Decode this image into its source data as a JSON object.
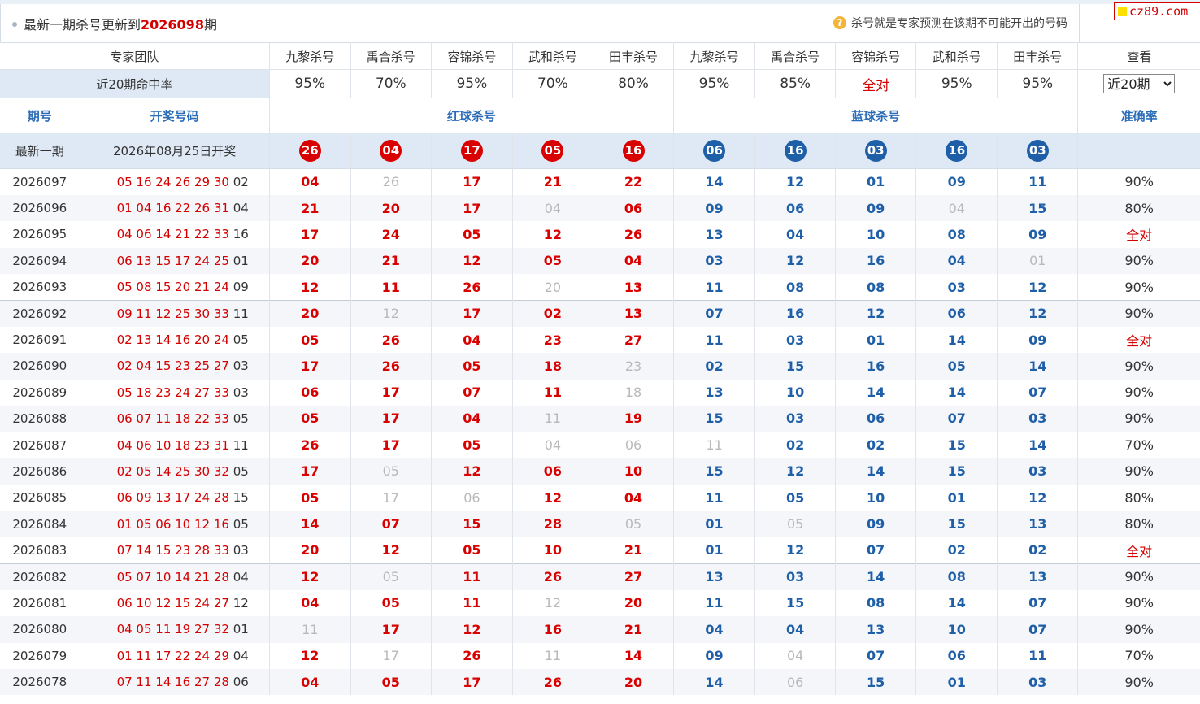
{
  "header": {
    "title_prefix": "最新一期杀号更新到",
    "issue": "2026098",
    "title_suffix": "期",
    "note": "杀号就是专家预测在该期不可能开出的号码",
    "help_glyph": "?"
  },
  "logo": {
    "text": "cz89.com"
  },
  "team": {
    "label": "专家团队",
    "experts": [
      "九黎杀号",
      "禹合杀号",
      "容锦杀号",
      "武和杀号",
      "田丰杀号",
      "九黎杀号",
      "禹合杀号",
      "容锦杀号",
      "武和杀号",
      "田丰杀号"
    ],
    "view_label": "查看"
  },
  "rate": {
    "label": "近20期命中率",
    "values": [
      "95%",
      "70%",
      "95%",
      "70%",
      "80%",
      "95%",
      "85%",
      "全对",
      "95%",
      "95%"
    ],
    "select_value": "近20期"
  },
  "section": {
    "issue_label": "期号",
    "draw_label": "开奖号码",
    "red_label": "红球杀号",
    "blue_label": "蓝球杀号",
    "acc_label": "准确率"
  },
  "latest": {
    "label": "最新一期",
    "date": "2026年08月25日开奖",
    "red": [
      "26",
      "04",
      "17",
      "05",
      "16"
    ],
    "blue": [
      "06",
      "16",
      "03",
      "16",
      "03"
    ]
  },
  "colors": {
    "red": "#d90000",
    "blue": "#1f5fa8",
    "accent_bg": "#dfe9f5",
    "miss": "#b9b9b9"
  },
  "rows": [
    {
      "issue": "2026097",
      "reds": "05 16 24 26 29 30",
      "blue": "02",
      "kills": [
        "04",
        "26",
        "17",
        "21",
        "22",
        "14",
        "12",
        "01",
        "09",
        "11"
      ],
      "miss": [
        1
      ],
      "acc": "90%"
    },
    {
      "issue": "2026096",
      "reds": "01 04 16 22 26 31",
      "blue": "04",
      "kills": [
        "21",
        "20",
        "17",
        "04",
        "06",
        "09",
        "06",
        "09",
        "04",
        "15"
      ],
      "miss": [
        3,
        8
      ],
      "acc": "80%"
    },
    {
      "issue": "2026095",
      "reds": "04 06 14 21 22 33",
      "blue": "16",
      "kills": [
        "17",
        "24",
        "05",
        "12",
        "26",
        "13",
        "04",
        "10",
        "08",
        "09"
      ],
      "miss": [],
      "acc": "全对"
    },
    {
      "issue": "2026094",
      "reds": "06 13 15 17 24 25",
      "blue": "01",
      "kills": [
        "20",
        "21",
        "12",
        "05",
        "04",
        "03",
        "12",
        "16",
        "04",
        "01"
      ],
      "miss": [
        9
      ],
      "acc": "90%"
    },
    {
      "issue": "2026093",
      "reds": "05 08 15 20 21 24",
      "blue": "09",
      "kills": [
        "12",
        "11",
        "26",
        "20",
        "13",
        "11",
        "08",
        "08",
        "03",
        "12"
      ],
      "miss": [
        3
      ],
      "acc": "90%"
    },
    {
      "issue": "2026092",
      "reds": "09 11 12 25 30 33",
      "blue": "11",
      "kills": [
        "20",
        "12",
        "17",
        "02",
        "13",
        "07",
        "16",
        "12",
        "06",
        "12"
      ],
      "miss": [
        1
      ],
      "acc": "90%"
    },
    {
      "issue": "2026091",
      "reds": "02 13 14 16 20 24",
      "blue": "05",
      "kills": [
        "05",
        "26",
        "04",
        "23",
        "27",
        "11",
        "03",
        "01",
        "14",
        "09"
      ],
      "miss": [],
      "acc": "全对"
    },
    {
      "issue": "2026090",
      "reds": "02 04 15 23 25 27",
      "blue": "03",
      "kills": [
        "17",
        "26",
        "05",
        "18",
        "23",
        "02",
        "15",
        "16",
        "05",
        "14"
      ],
      "miss": [
        4
      ],
      "acc": "90%"
    },
    {
      "issue": "2026089",
      "reds": "05 18 23 24 27 33",
      "blue": "03",
      "kills": [
        "06",
        "17",
        "07",
        "11",
        "18",
        "13",
        "10",
        "14",
        "14",
        "07"
      ],
      "miss": [
        4
      ],
      "acc": "90%"
    },
    {
      "issue": "2026088",
      "reds": "06 07 11 18 22 33",
      "blue": "05",
      "kills": [
        "05",
        "17",
        "04",
        "11",
        "19",
        "15",
        "03",
        "06",
        "07",
        "03"
      ],
      "miss": [
        3
      ],
      "acc": "90%"
    },
    {
      "issue": "2026087",
      "reds": "04 06 10 18 23 31",
      "blue": "11",
      "kills": [
        "26",
        "17",
        "05",
        "04",
        "06",
        "11",
        "02",
        "02",
        "15",
        "14"
      ],
      "miss": [
        3,
        4,
        5
      ],
      "acc": "70%"
    },
    {
      "issue": "2026086",
      "reds": "02 05 14 25 30 32",
      "blue": "05",
      "kills": [
        "17",
        "05",
        "12",
        "06",
        "10",
        "15",
        "12",
        "14",
        "15",
        "03"
      ],
      "miss": [
        1
      ],
      "acc": "90%"
    },
    {
      "issue": "2026085",
      "reds": "06 09 13 17 24 28",
      "blue": "15",
      "kills": [
        "05",
        "17",
        "06",
        "12",
        "04",
        "11",
        "05",
        "10",
        "01",
        "12"
      ],
      "miss": [
        1,
        2
      ],
      "acc": "80%"
    },
    {
      "issue": "2026084",
      "reds": "01 05 06 10 12 16",
      "blue": "05",
      "kills": [
        "14",
        "07",
        "15",
        "28",
        "05",
        "01",
        "05",
        "09",
        "15",
        "13"
      ],
      "miss": [
        4,
        6
      ],
      "acc": "80%"
    },
    {
      "issue": "2026083",
      "reds": "07 14 15 23 28 33",
      "blue": "03",
      "kills": [
        "20",
        "12",
        "05",
        "10",
        "21",
        "01",
        "12",
        "07",
        "02",
        "02"
      ],
      "miss": [],
      "acc": "全对"
    },
    {
      "issue": "2026082",
      "reds": "05 07 10 14 21 28",
      "blue": "04",
      "kills": [
        "12",
        "05",
        "11",
        "26",
        "27",
        "13",
        "03",
        "14",
        "08",
        "13"
      ],
      "miss": [
        1
      ],
      "acc": "90%"
    },
    {
      "issue": "2026081",
      "reds": "06 10 12 15 24 27",
      "blue": "12",
      "kills": [
        "04",
        "05",
        "11",
        "12",
        "20",
        "11",
        "15",
        "08",
        "14",
        "07"
      ],
      "miss": [
        3
      ],
      "acc": "90%"
    },
    {
      "issue": "2026080",
      "reds": "04 05 11 19 27 32",
      "blue": "01",
      "kills": [
        "11",
        "17",
        "12",
        "16",
        "21",
        "04",
        "04",
        "13",
        "10",
        "07"
      ],
      "miss": [
        0
      ],
      "acc": "90%"
    },
    {
      "issue": "2026079",
      "reds": "01 11 17 22 24 29",
      "blue": "04",
      "kills": [
        "12",
        "17",
        "26",
        "11",
        "14",
        "09",
        "04",
        "07",
        "06",
        "11"
      ],
      "miss": [
        1,
        3,
        6
      ],
      "acc": "70%"
    },
    {
      "issue": "2026078",
      "reds": "07 11 14 16 27 28",
      "blue": "06",
      "kills": [
        "04",
        "05",
        "17",
        "26",
        "20",
        "14",
        "06",
        "15",
        "01",
        "03"
      ],
      "miss": [
        6
      ],
      "acc": "90%"
    }
  ]
}
